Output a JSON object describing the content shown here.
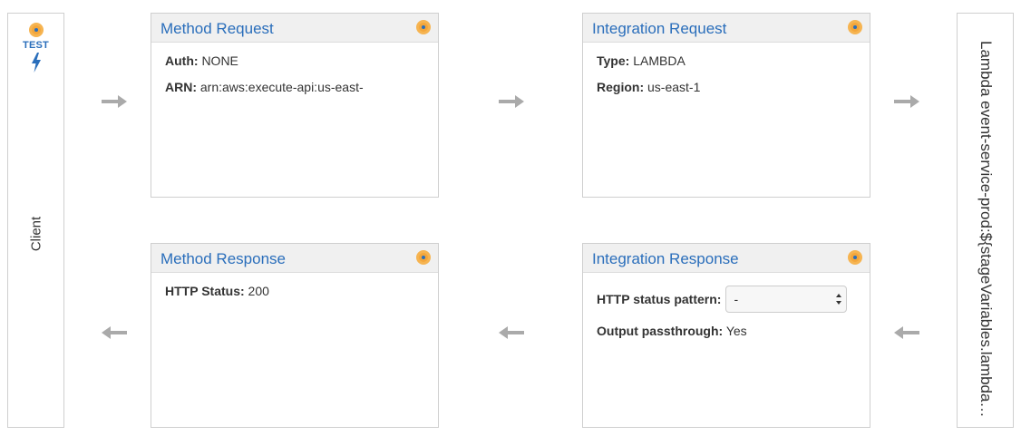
{
  "client": {
    "test_label": "TEST",
    "label": "Client",
    "icons": [
      "test-dot-icon",
      "lightning-bolt-icon"
    ]
  },
  "method_request": {
    "title": "Method Request",
    "auth_label": "Auth:",
    "auth_value": "NONE",
    "arn_label": "ARN:",
    "arn_value": "arn:aws:execute-api:us-east-"
  },
  "integration_request": {
    "title": "Integration Request",
    "type_label": "Type:",
    "type_value": "LAMBDA",
    "region_label": "Region:",
    "region_value": "us-east-1"
  },
  "lambda": {
    "label": "Lambda event-service-prod:${stageVariables.lambdaA..."
  },
  "method_response": {
    "title": "Method Response",
    "status_label": "HTTP Status:",
    "status_value": "200"
  },
  "integration_response": {
    "title": "Integration Response",
    "pattern_label": "HTTP status pattern:",
    "pattern_value": "-",
    "passthrough_label": "Output passthrough:",
    "passthrough_value": "Yes"
  },
  "colors": {
    "accent": "#2a6ebb",
    "indicator": "#f3a63b",
    "arrow": "#aaaaaa"
  }
}
